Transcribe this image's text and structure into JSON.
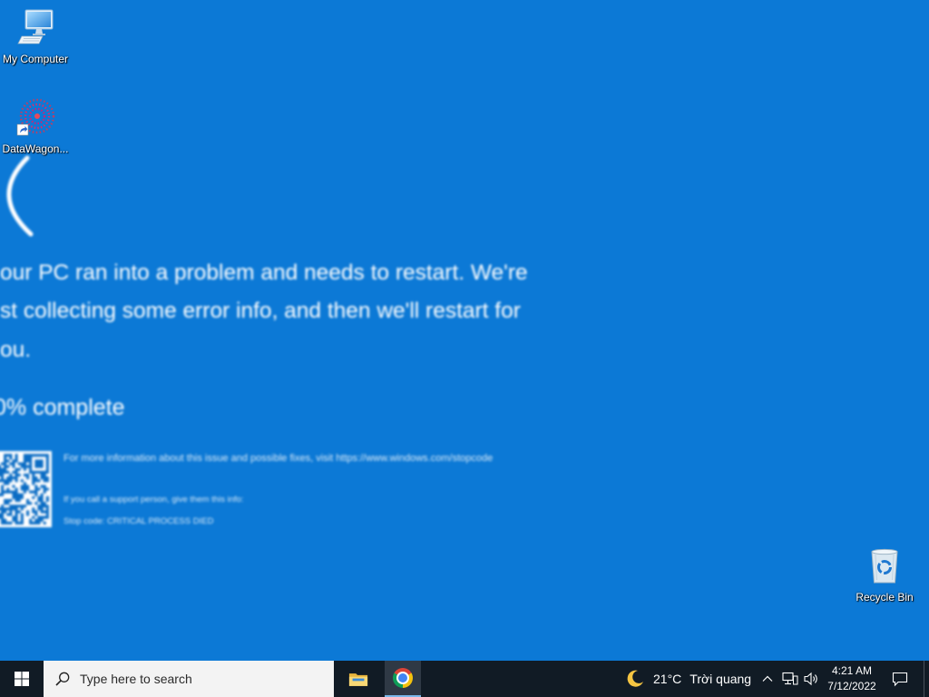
{
  "desktop": {
    "background_color": "#0c79d6",
    "icons": [
      {
        "label": "My Computer",
        "icon": "computer-icon"
      },
      {
        "label": "DataWagon...",
        "icon": "datawagon-shortcut-icon"
      },
      {
        "label": "Recycle Bin",
        "icon": "recycle-bin-icon"
      }
    ]
  },
  "wallpaper": {
    "message_lines": [
      "our PC ran into a problem and needs to restart. We're",
      "st collecting some error info, and then we'll restart for",
      "ou."
    ],
    "progress": "0% complete",
    "info_text": "For more information about this issue and possible fixes, visit https://www.windows.com/stopcode",
    "support_text": "If you call a support person, give them this info:",
    "stop_code": "Stop code: CRITICAL PROCESS DIED",
    "qr_icon": "qr-code-icon"
  },
  "taskbar": {
    "start_icon": "windows-logo-icon",
    "search_placeholder": "Type here to search",
    "pinned_icons": [
      "file-explorer-icon",
      "chrome-icon"
    ],
    "active_icon": "chrome-icon",
    "weather": {
      "icon": "moon-icon",
      "temperature": "21°C",
      "condition": "Trời quang"
    },
    "tray_icons": [
      "chevron-up-icon",
      "network-icon",
      "volume-icon"
    ],
    "clock": {
      "time": "4:21 AM",
      "date": "7/12/2022"
    },
    "notification_icon": "notification-icon"
  }
}
